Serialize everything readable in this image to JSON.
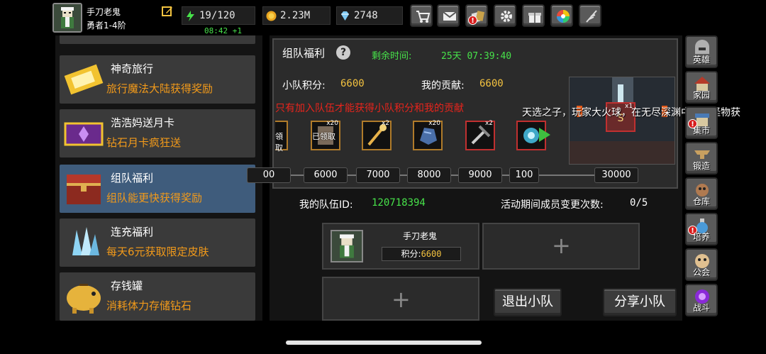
{
  "player": {
    "name": "手刀老鬼",
    "rank": "勇者1-4阶"
  },
  "stats": {
    "energy": "19/120",
    "energy_timer": "08:42 +1",
    "gold": "2.23M",
    "gems": "2748"
  },
  "top_buttons": [
    "cart-icon",
    "mail-icon",
    "cards-icon",
    "gear-icon",
    "gift-icon",
    "color-wheel-icon",
    "feather-icon"
  ],
  "left_list": [
    {
      "title": "神奇旅行",
      "subtitle": "旅行魔法大陆获得奖励",
      "icon": "ticket-icon"
    },
    {
      "title": "浩浩妈送月卡",
      "subtitle": "钻石月卡疯狂送",
      "icon": "monthly-card-icon"
    },
    {
      "title": "组队福利",
      "subtitle": "组队能更快获得奖励",
      "icon": "treasure-chest-icon",
      "active": true
    },
    {
      "title": "连充福利",
      "subtitle": "每天6元获取限定皮肤",
      "icon": "crystal-icon"
    },
    {
      "title": "存钱罐",
      "subtitle": "消耗体力存储钻石",
      "icon": "piggy-bank-icon"
    }
  ],
  "welfare": {
    "title": "组队福利",
    "time_left_label": "剩余时间:",
    "time_left": "25天 07:39:40",
    "squad_score_label": "小队积分:",
    "squad_score": "6600",
    "my_contrib_label": "我的贡献:",
    "my_contrib": "6600",
    "notice": "只有加入队伍才能获得小队积分和我的贡献",
    "rewards": [
      {
        "name": "reward-partial",
        "count": "",
        "claimed": "領取"
      },
      {
        "name": "reward-scroll",
        "count": "x20",
        "claimed": "已领取"
      },
      {
        "name": "reward-staff",
        "count": "x2",
        "claimed": ""
      },
      {
        "name": "reward-ore",
        "count": "x20",
        "claimed": ""
      },
      {
        "name": "reward-pickaxe",
        "count": "x2",
        "claimed": ""
      },
      {
        "name": "reward-orb",
        "count": "",
        "claimed": ""
      }
    ],
    "milestones": [
      "00",
      "6000",
      "7000",
      "8000",
      "9000",
      "100",
      "30000"
    ],
    "video_item_count": "x1",
    "danmaku": "天选之子，玩家大火球，在无尽深渊中击杀怪物获"
  },
  "team": {
    "id_label": "我的队伍ID:",
    "id": "120718394",
    "changes_label": "活动期间成员变更次数:",
    "changes": "0/5",
    "member": {
      "name": "手刀老鬼",
      "score_label": "积分:",
      "score": "6600"
    },
    "add_symbol": "+",
    "leave_button": "退出小队",
    "share_button": "分享小队"
  },
  "sidebar": [
    {
      "label": "英雄",
      "icon": "helmet-icon"
    },
    {
      "label": "家园",
      "icon": "house-icon"
    },
    {
      "label": "集市",
      "icon": "market-icon",
      "alert": "!"
    },
    {
      "label": "锻造",
      "icon": "anvil-icon"
    },
    {
      "label": "仓库",
      "icon": "warehouse-icon"
    },
    {
      "label": "培养",
      "icon": "potion-icon",
      "alert": "!"
    },
    {
      "label": "公会",
      "icon": "guild-icon"
    },
    {
      "label": "战斗",
      "icon": "portal-icon"
    }
  ],
  "colors": {
    "accent_green": "#47e24a",
    "accent_orange": "#f29a1a",
    "accent_gold": "#f4c340",
    "alert_red": "#e8241c",
    "active_item": "#3f5c7c"
  }
}
